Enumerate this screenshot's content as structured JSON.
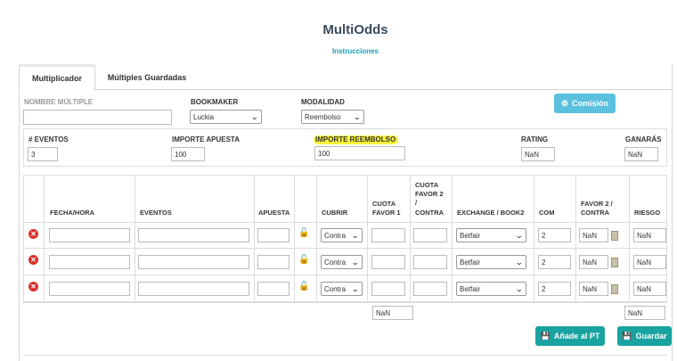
{
  "header": {
    "title": "MultiOdds",
    "instructions_link": "Instrucciones"
  },
  "tabs": [
    {
      "label": "Multiplicador",
      "active": true
    },
    {
      "label": "Múltiples Guardadas",
      "active": false
    }
  ],
  "form": {
    "nombre_label": "NOMBRE MÚLTIPLE",
    "nombre_value": "",
    "bookmaker_label": "BOOKMAKER",
    "bookmaker_value": "Luckia",
    "modalidad_label": "MODALIDAD",
    "modalidad_value": "Reembolso",
    "comision_button": "Comisión",
    "eventos_label": "# EVENTOS",
    "eventos_value": "3",
    "importe_apuesta_label": "IMPORTE APUESTA",
    "importe_apuesta_value": "100",
    "importe_reembolso_label": "IMPORTE REEMBOLSO",
    "importe_reembolso_value": "100",
    "rating_label": "RATING",
    "rating_value": "NaN",
    "ganaras_label": "GANARÁS",
    "ganaras_value": "NaN"
  },
  "table": {
    "headers": {
      "fecha": "FECHA/HORA",
      "eventos": "EVENTOS",
      "apuesta": "APUESTA",
      "cubrir": "CUBRIR",
      "cuota1_l1": "CUOTA",
      "cuota1_l2": "FAVOR 1",
      "cuota2_l1": "CUOTA",
      "cuota2_l2": "FAVOR 2",
      "cuota2_l3": "/",
      "cuota2_l4": "CONTRA",
      "exchange": "EXCHANGE / BOOK2",
      "com": "COM",
      "favor2_l1": "FAVOR 2 /",
      "favor2_l2": "CONTRA",
      "riesgo": "RIESGO"
    },
    "rows": [
      {
        "fecha": "",
        "evento": "",
        "apuesta": "",
        "cubrir": "Contra",
        "cuota1": "",
        "cuota2": "",
        "exchange": "Betfair",
        "com": "2",
        "favor2": "NaN",
        "riesgo": "NaN"
      },
      {
        "fecha": "",
        "evento": "",
        "apuesta": "",
        "cubrir": "Contra",
        "cuota1": "",
        "cuota2": "",
        "exchange": "Betfair",
        "com": "2",
        "favor2": "NaN",
        "riesgo": "NaN"
      },
      {
        "fecha": "",
        "evento": "",
        "apuesta": "",
        "cubrir": "Contra",
        "cuota1": "",
        "cuota2": "",
        "exchange": "Betfair",
        "com": "2",
        "favor2": "NaN",
        "riesgo": "NaN"
      }
    ],
    "total_cuota": "NaN",
    "total_riesgo": "NaN"
  },
  "actions": {
    "add_pt": "Añade al PT",
    "save": "Guardar"
  },
  "colors": {
    "teal": "#19a3a0",
    "light_blue": "#5bc0de",
    "delete_red": "#d9312b",
    "highlight": "#fbf43a"
  }
}
